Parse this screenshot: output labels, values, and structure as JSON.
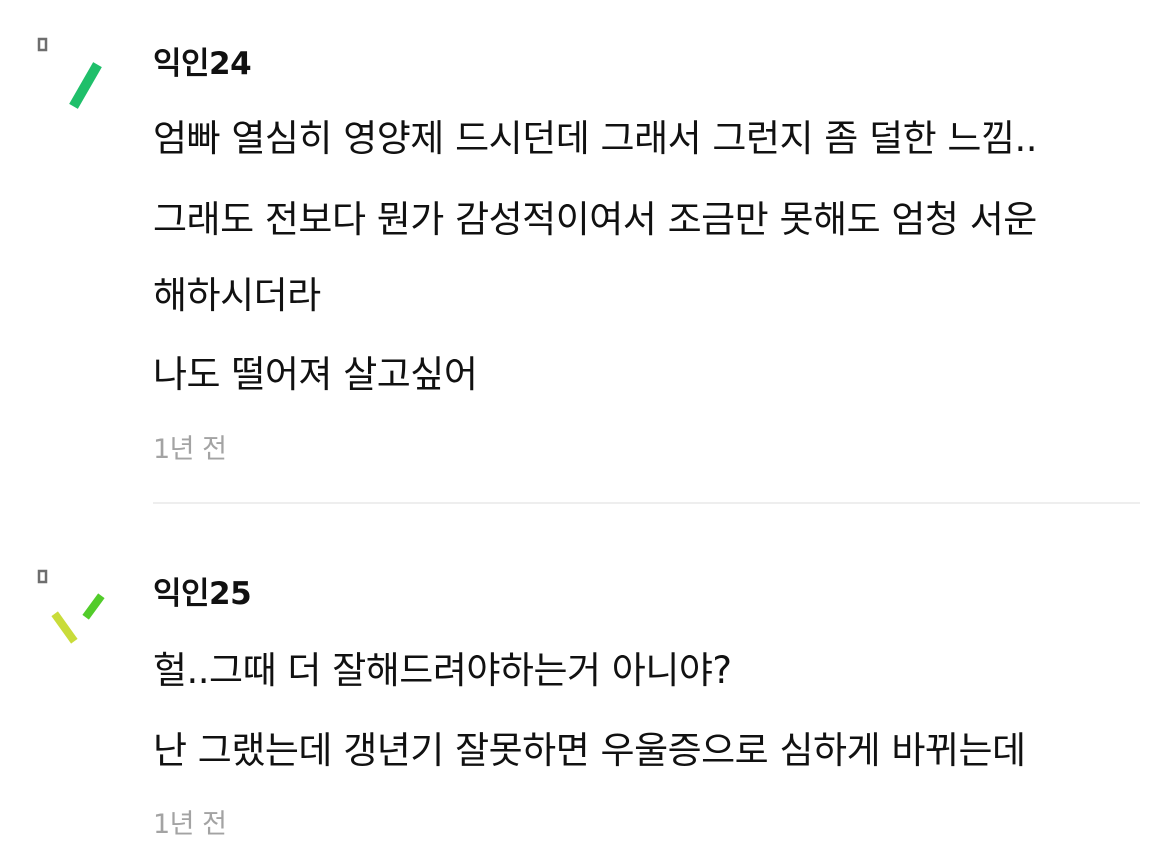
{
  "comments": [
    {
      "author": "익인24",
      "lines": [
        "엄빠 열심히 영양제 드시던데 그래서 그런지 좀 덜한 느낌..",
        "그래도 전보다 뭔가 감성적이여서 조금만 못해도 엄청 서운",
        "해하시더라",
        "나도 떨어져 살고싶어"
      ],
      "time": "1년 전"
    },
    {
      "author": "익인25",
      "lines": [
        "헐..그때 더 잘해드려야하는거 아니야?",
        "난 그랬는데 갱년기 잘못하면 우울증으로 심하게 바뀌는데"
      ],
      "time": "1년 전"
    }
  ],
  "colors": {
    "avatar1_stroke": "#1fbf6a",
    "avatar2_stroke_left": "#c9dc3a",
    "avatar2_stroke_right": "#52cc2a",
    "avatar_marker": "#6e6e6e",
    "time_text": "#a3a3a3",
    "divider": "#eeeeee"
  },
  "icons": [
    "anonymous-avatar-icon"
  ]
}
